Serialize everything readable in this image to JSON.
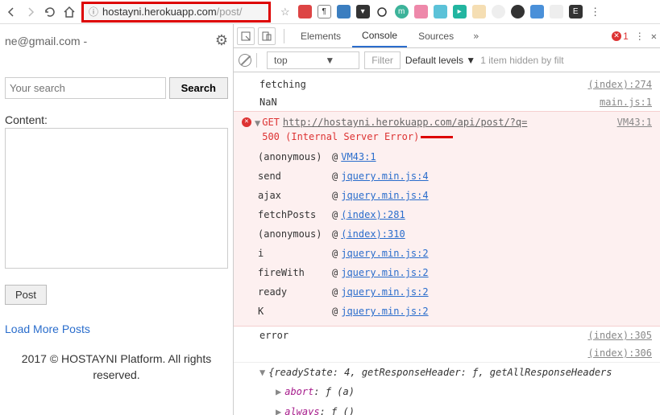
{
  "browser": {
    "url_host": "hostayni.herokuapp.com",
    "url_path": "/post/"
  },
  "page": {
    "email_fragment": "ne@gmail.com -",
    "search_placeholder": "Your search",
    "search_button": "Search",
    "content_label": "Content:",
    "post_button": "Post",
    "load_more": "Load More Posts",
    "footer": "2017 © HOSTAYNI Platform. All rights reserved."
  },
  "devtools": {
    "tabs": {
      "elements": "Elements",
      "console": "Console",
      "sources": "Sources"
    },
    "error_count": "1",
    "filter": {
      "context": "top",
      "filter_placeholder": "Filter",
      "levels": "Default levels",
      "hidden": "1 item hidden by filt"
    },
    "logs": [
      {
        "msg": "fetching",
        "src": "(index):274"
      },
      {
        "msg": "NaN",
        "src": "main.js:1"
      }
    ],
    "error": {
      "method": "GET",
      "url": "http://hostayni.herokuapp.com/api/post/?q=",
      "status": "500 (Internal Server Error)",
      "src": "VM43:1",
      "trace": [
        {
          "fn": "(anonymous)",
          "link": "VM43:1"
        },
        {
          "fn": "send",
          "link": "jquery.min.js:4"
        },
        {
          "fn": "ajax",
          "link": "jquery.min.js:4"
        },
        {
          "fn": "fetchPosts",
          "link": "(index):281"
        },
        {
          "fn": "(anonymous)",
          "link": "(index):310"
        },
        {
          "fn": "i",
          "link": "jquery.min.js:2"
        },
        {
          "fn": "fireWith",
          "link": "jquery.min.js:2"
        },
        {
          "fn": "ready",
          "link": "jquery.min.js:2"
        },
        {
          "fn": "K",
          "link": "jquery.min.js:2"
        }
      ]
    },
    "post_logs": [
      {
        "msg": "error",
        "src": "(index):305"
      },
      {
        "msg": "",
        "src": "(index):306"
      }
    ],
    "object": {
      "head": "{readyState: 4, getResponseHeader: ƒ, getAllResponseHeaders",
      "props": [
        {
          "k": "abort",
          "v": "ƒ (a)"
        },
        {
          "k": "always",
          "v": "ƒ ()"
        }
      ]
    }
  }
}
